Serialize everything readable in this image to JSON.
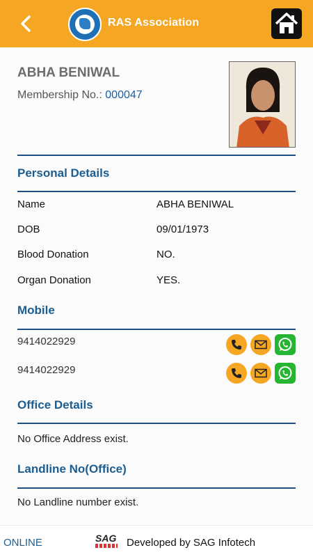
{
  "header": {
    "title": "RAS Association",
    "back_icon": "chevron-left-icon",
    "home_icon": "home-icon"
  },
  "profile": {
    "name": "ABHA BENIWAL",
    "membership_label": "Membership No.:",
    "membership_no": "000047"
  },
  "personal": {
    "title": "Personal Details",
    "rows": [
      {
        "label": "Name",
        "value": "ABHA BENIWAL"
      },
      {
        "label": "DOB",
        "value": "09/01/1973"
      },
      {
        "label": "Blood Donation",
        "value": "NO."
      },
      {
        "label": "Organ Donation",
        "value": "YES."
      }
    ]
  },
  "mobile": {
    "title": "Mobile",
    "numbers": [
      "9414022929",
      "9414022929"
    ]
  },
  "office": {
    "title": "Office Details",
    "message": "No Office Address exist."
  },
  "landline": {
    "title": "Landline No(Office)",
    "message": "No Landline number exist."
  },
  "footer": {
    "status": "ONLINE",
    "logo_text": "SAG",
    "developed": "Developed by SAG Infotech"
  },
  "colors": {
    "accent": "#f5a623",
    "heading": "#1d5d8f",
    "whatsapp": "#25b532"
  }
}
